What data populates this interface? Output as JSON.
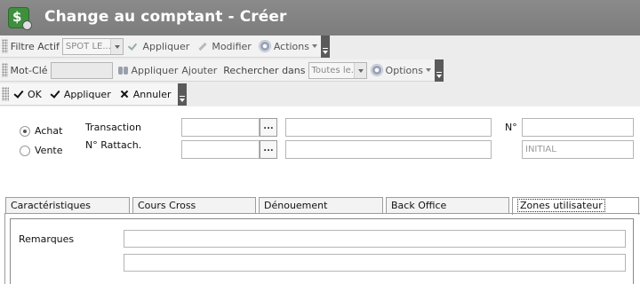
{
  "window": {
    "title": "Change au comptant - Créer"
  },
  "toolbar1": {
    "filter_label": "Filtre Actif",
    "filter_value": "SPOT LE...",
    "apply_label": "Appliquer",
    "modify_label": "Modifier",
    "actions_label": "Actions"
  },
  "toolbar2": {
    "keyword_label": "Mot-Clé",
    "keyword_value": "",
    "apply_label": "Appliquer",
    "add_label": "Ajouter",
    "search_in_label": "Rechercher dans",
    "search_in_value": "Toutes le...",
    "options_label": "Options"
  },
  "toolbar3": {
    "ok_label": "OK",
    "apply_label": "Appliquer",
    "cancel_label": "Annuler"
  },
  "form": {
    "radio_buy_label": "Achat",
    "radio_sell_label": "Vente",
    "radio_selected": "Achat",
    "transaction_label": "Transaction",
    "attachment_label": "N° Rattach.",
    "number_label": "N°",
    "transaction_value": "",
    "transaction_desc": "",
    "attachment_value": "",
    "attachment_desc": "",
    "number_value": "",
    "status_value": "INITIAL",
    "lookup_button": "..."
  },
  "tabs": [
    {
      "label": "Caractéristiques",
      "active": false
    },
    {
      "label": "Cours Cross",
      "active": false
    },
    {
      "label": "Dénouement",
      "active": false
    },
    {
      "label": "Back Office",
      "active": false
    },
    {
      "label": "Zones utilisateur",
      "active": true
    }
  ],
  "panel": {
    "remarks_label": "Remarques",
    "remarks_line1": "",
    "remarks_line2": ""
  },
  "colors": {
    "titlebar": "#808080",
    "toolbar_bg": "#f2f2f2",
    "overflow_button": "#5a5a5a",
    "app_icon": "#3f8f3f"
  }
}
